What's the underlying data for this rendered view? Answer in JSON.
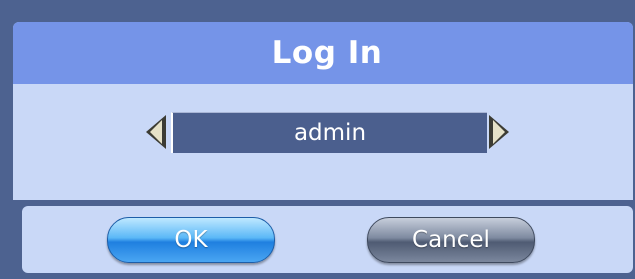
{
  "dialog": {
    "title": "Log In",
    "user": {
      "value": "admin",
      "prev_icon": "triangle-left-icon",
      "next_icon": "triangle-right-icon"
    },
    "buttons": {
      "ok_label": "OK",
      "cancel_label": "Cancel"
    }
  },
  "colors": {
    "title_bar": "#7594e8",
    "panel": "#c9d8f7",
    "frame": "#4d6290",
    "user_box": "#4b5f8e",
    "ok_button": "#3a9af0",
    "cancel_button": "#68748c"
  }
}
